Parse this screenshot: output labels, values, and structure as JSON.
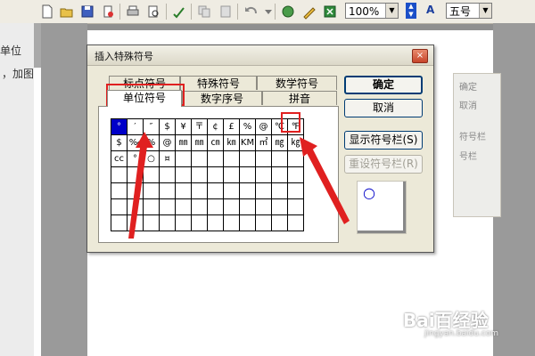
{
  "toolbar": {
    "zoom": "100%",
    "font_size": "五号",
    "font_style_label": "A"
  },
  "background": {
    "left_text_1": "单位",
    "left_text_2": "，加图",
    "pane_items": [
      "确定",
      "取消",
      "符号栏",
      "号栏"
    ]
  },
  "dialog": {
    "title": "插入特殊符号",
    "close": "×",
    "tabs_row_back": [
      "标点符号",
      "特殊符号",
      "数学符号"
    ],
    "tabs_row_front": [
      "单位符号",
      "数字序号",
      "拼音"
    ],
    "active_tab": "单位符号",
    "buttons": {
      "ok": "确定",
      "cancel": "取消",
      "show_toolbar": "显示符号栏(S)",
      "reset_toolbar": "重设符号栏(R)"
    },
    "symbol_rows": [
      [
        "°",
        "′",
        "″",
        "$",
        "¥",
        "〒",
        "¢",
        "£",
        "%",
        "@",
        "℃",
        "℉"
      ],
      [
        "$",
        "‰",
        "%",
        "@",
        "㎜",
        "㎜",
        "㎝",
        "㎞",
        "KM",
        "㎡",
        "㎎",
        "㎏"
      ],
      [
        "cc",
        "°",
        "○",
        "¤",
        "",
        "",
        "",
        "",
        "",
        "",
        "",
        ""
      ],
      [
        "",
        "",
        "",
        "",
        "",
        "",
        "",
        "",
        "",
        "",
        "",
        ""
      ],
      [
        "",
        "",
        "",
        "",
        "",
        "",
        "",
        "",
        "",
        "",
        "",
        ""
      ],
      [
        "",
        "",
        "",
        "",
        "",
        "",
        "",
        "",
        "",
        "",
        "",
        ""
      ],
      [
        "",
        "",
        "",
        "",
        "",
        "",
        "",
        "",
        "",
        "",
        "",
        ""
      ]
    ],
    "selected_symbol": "°",
    "preview_symbol": "○"
  },
  "watermark": {
    "brand": "Bai百经验",
    "sub": "jingyan.baidu.com"
  },
  "colors": {
    "annotation": "#e02020",
    "selected_cell": "#0000c8"
  }
}
